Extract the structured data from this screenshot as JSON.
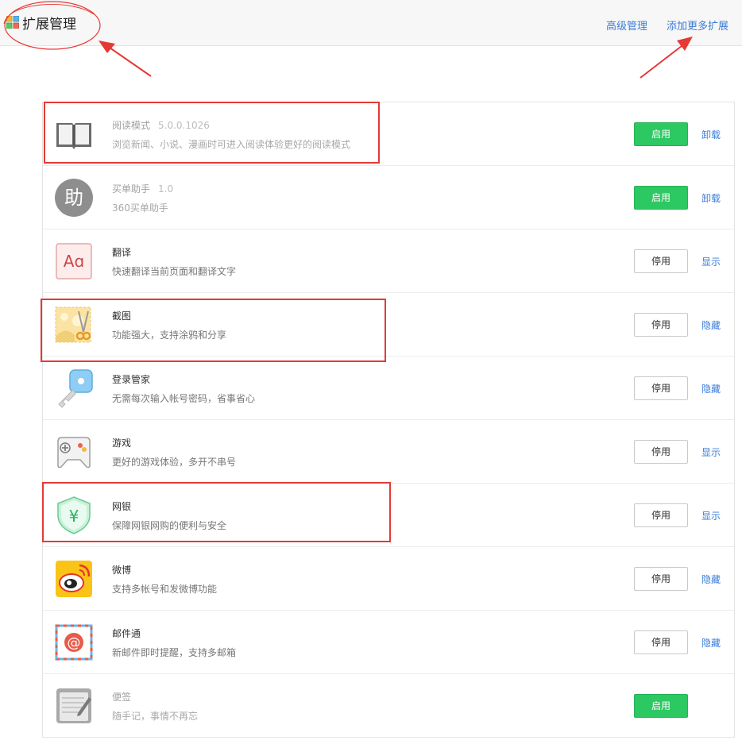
{
  "header": {
    "title": "扩展管理",
    "advanced_label": "高级管理",
    "add_more_label": "添加更多扩展"
  },
  "extensions": [
    {
      "name": "阅读模式",
      "version": "5.0.0.1026",
      "desc": "浏览新闻、小说、漫画时可进入阅读体验更好的阅读模式",
      "button": "启用",
      "action": "卸载",
      "icon": "book-icon"
    },
    {
      "name": "买单助手",
      "version": "1.0",
      "desc": "360买单助手",
      "button": "启用",
      "action": "卸载",
      "icon": "helper-icon"
    },
    {
      "name": "翻译",
      "desc": "快速翻译当前页面和翻译文字",
      "button": "停用",
      "action": "显示",
      "icon": "translate-icon"
    },
    {
      "name": "截图",
      "desc": "功能强大，支持涂鸦和分享",
      "button": "停用",
      "action": "隐藏",
      "icon": "scissors-icon"
    },
    {
      "name": "登录管家",
      "desc": "无需每次输入帐号密码，省事省心",
      "button": "停用",
      "action": "隐藏",
      "icon": "key-icon"
    },
    {
      "name": "游戏",
      "desc": "更好的游戏体验，多开不串号",
      "button": "停用",
      "action": "显示",
      "icon": "gamepad-icon"
    },
    {
      "name": "网银",
      "desc": "保障网银网购的便利与安全",
      "button": "停用",
      "action": "显示",
      "icon": "shield-yuan-icon"
    },
    {
      "name": "微博",
      "desc": "支持多帐号和发微博功能",
      "button": "停用",
      "action": "隐藏",
      "icon": "weibo-icon"
    },
    {
      "name": "邮件通",
      "desc": "新邮件即时提醒，支持多邮箱",
      "button": "停用",
      "action": "隐藏",
      "icon": "mail-at-icon"
    },
    {
      "name": "便签",
      "desc": "随手记，事情不再忘",
      "button": "启用",
      "action": "",
      "icon": "notepad-icon"
    }
  ],
  "colors": {
    "accent_green": "#2cc862",
    "link_blue": "#3b7dd8",
    "annotation_red": "#e53935"
  }
}
